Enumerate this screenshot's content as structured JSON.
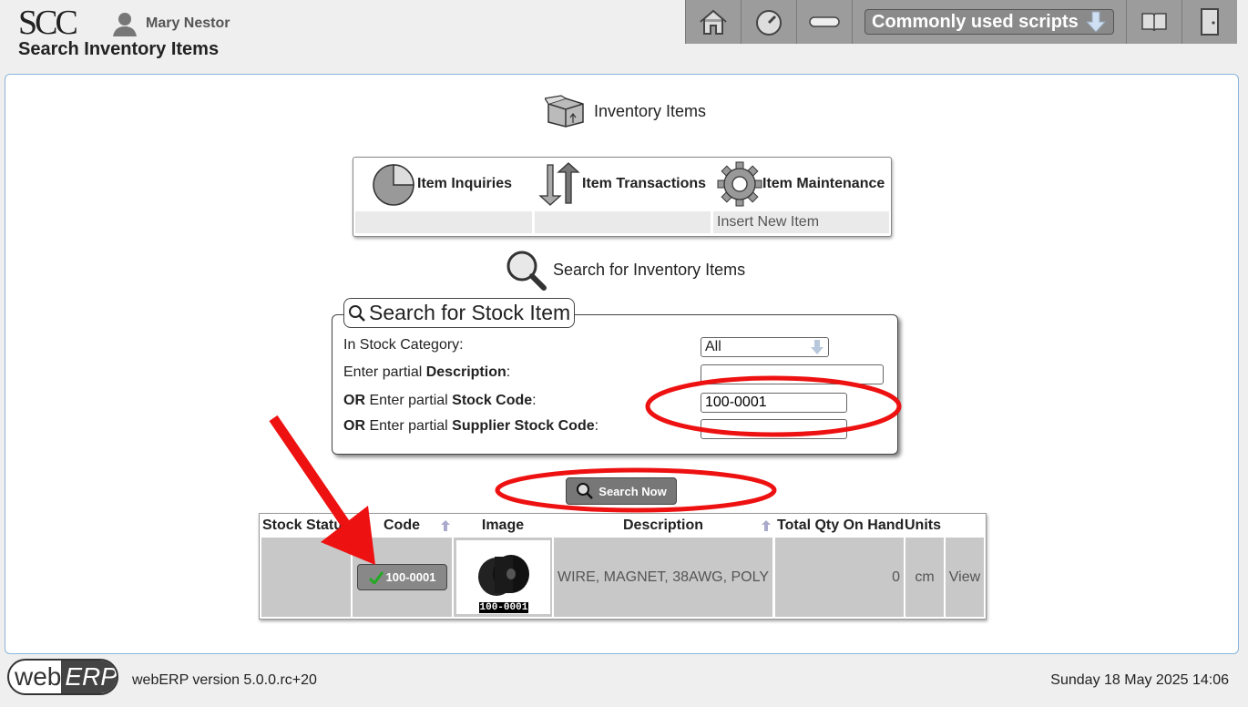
{
  "header": {
    "logo": "SCC",
    "user_name": "Mary Nestor",
    "page_title": "Search Inventory Items",
    "scripts_label": "Commonly used scripts",
    "toolbar_icons": [
      "home-icon",
      "dashboard-icon",
      "toggle-icon",
      "manual-icon",
      "logout-icon"
    ]
  },
  "main": {
    "section_title": "Inventory Items",
    "menu": {
      "inquiries": "Item Inquiries",
      "transactions": "Item Transactions",
      "maintenance": "Item Maintenance",
      "insert_link": "Insert New Item"
    },
    "search_title": "Search for Inventory Items",
    "form": {
      "legend": "Search for Stock Item",
      "category_label": "In Stock Category:",
      "category_value": "All",
      "desc_label_pre": "Enter partial ",
      "desc_label_bold": "Description",
      "desc_label_post": ":",
      "code_label_or": "OR",
      "code_label_pre": " Enter partial ",
      "code_label_bold": "Stock Code",
      "code_label_post": ":",
      "code_value": "100-0001",
      "supp_label_or": "OR",
      "supp_label_pre": " Enter partial ",
      "supp_label_bold": "Supplier Stock Code",
      "supp_label_post": ":",
      "search_button": "Search Now"
    },
    "results": {
      "headers": [
        "Stock Status",
        "Code",
        "Image",
        "Description",
        "Total Qty On Hand",
        "Units"
      ],
      "row": {
        "code": "100-0001",
        "image_caption": "100-0001",
        "description": "WIRE, MAGNET, 38AWG, POLY",
        "qty": "0",
        "units": "cm",
        "view": "View"
      }
    }
  },
  "footer": {
    "logo_light": "web",
    "logo_dark": "ERP",
    "version": "webERP version 5.0.0.rc+20",
    "datetime": "Sunday 18 May 2025 14:06"
  },
  "colors": {
    "annotation": "#ee1111",
    "toolbar": "#9c9c9c",
    "accent_border": "#8cb4d8"
  }
}
